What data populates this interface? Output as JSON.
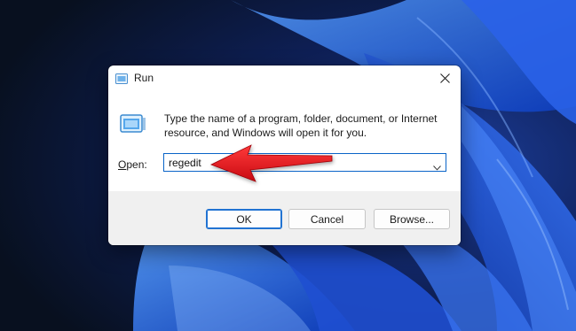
{
  "window": {
    "title": "Run",
    "close_icon": "close-icon",
    "title_icon": "run-icon"
  },
  "content": {
    "description": "Type the name of a program, folder, document, or Internet resource, and Windows will open it for you.",
    "open_label_prefix": "",
    "open_label_accel": "O",
    "open_label_rest": "pen:",
    "input_value": "regedit",
    "dropdown_icon": "chevron-down-icon"
  },
  "buttons": {
    "ok": "OK",
    "cancel": "Cancel",
    "browse": "Browse..."
  },
  "annotation": {
    "arrow_color": "#e8141c",
    "arrow_icon": "red-arrow-pointer"
  },
  "colors": {
    "accent": "#0a64c8",
    "footer": "#f0f0f0",
    "wallpaper": "#0b1326"
  }
}
